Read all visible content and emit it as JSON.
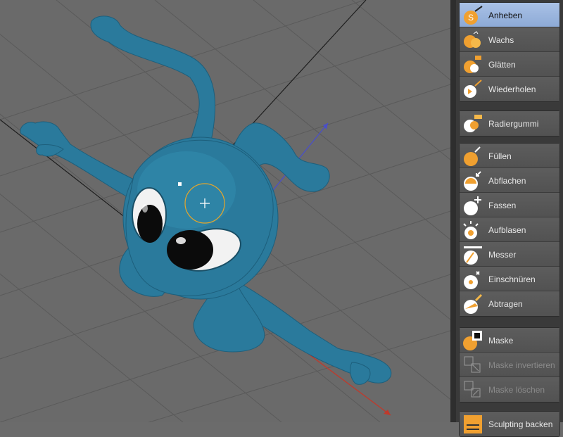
{
  "viewport": {
    "label": "3D viewport",
    "colors": {
      "background": "#6a6a6a",
      "model": "#2a7a9c",
      "brush_ring": "#e6a62a",
      "axis_red": "#c0392b",
      "axis_blue": "#4a4fc8"
    }
  },
  "brush_panel": {
    "group1": [
      {
        "label": "Anheben",
        "icon": "pull-brush-icon",
        "active": true
      },
      {
        "label": "Wachs",
        "icon": "wax-brush-icon"
      },
      {
        "label": "Glätten",
        "icon": "smooth-brush-icon"
      },
      {
        "label": "Wiederholen",
        "icon": "repeat-brush-icon"
      }
    ],
    "group2": [
      {
        "label": "Radiergummi",
        "icon": "eraser-brush-icon"
      }
    ],
    "group3": [
      {
        "label": "Füllen",
        "icon": "fill-brush-icon"
      },
      {
        "label": "Abflachen",
        "icon": "flatten-brush-icon"
      },
      {
        "label": "Fassen",
        "icon": "grab-brush-icon"
      },
      {
        "label": "Aufblasen",
        "icon": "inflate-brush-icon"
      },
      {
        "label": "Messer",
        "icon": "knife-brush-icon"
      },
      {
        "label": "Einschnüren",
        "icon": "pinch-brush-icon"
      },
      {
        "label": "Abtragen",
        "icon": "scrape-brush-icon"
      }
    ],
    "group4": [
      {
        "label": "Maske",
        "icon": "mask-brush-icon"
      },
      {
        "label": "Maske invertieren",
        "icon": "mask-invert-icon",
        "disabled": true
      },
      {
        "label": "Maske löschen",
        "icon": "mask-clear-icon",
        "disabled": true
      }
    ],
    "group5": [
      {
        "label": "Sculpting backen",
        "icon": "bake-sculpt-icon"
      }
    ],
    "colors": {
      "active_bg": "#9db6de",
      "button_bg": "#565656",
      "icon_orange": "#f0a030"
    }
  }
}
